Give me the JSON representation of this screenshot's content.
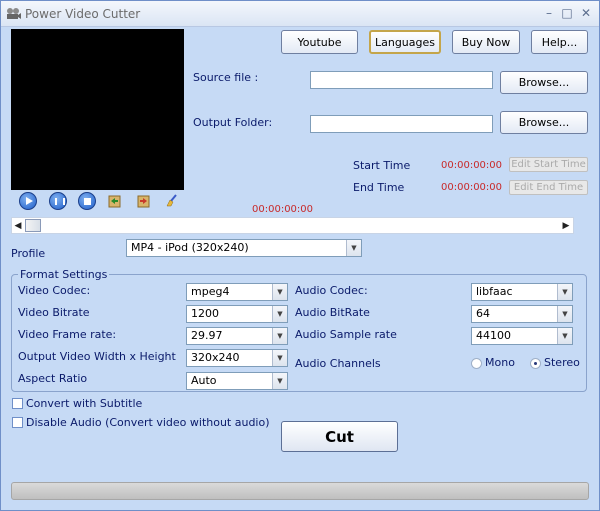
{
  "window": {
    "title": "Power Video Cutter",
    "minimize": "–",
    "maximize": "□",
    "close": "✕"
  },
  "toolbar": {
    "youtube": "Youtube",
    "languages": "Languages",
    "buy_now": "Buy Now",
    "help": "Help..."
  },
  "source": {
    "label": "Source file :",
    "value": "",
    "browse": "Browse..."
  },
  "output": {
    "label": "Output Folder:",
    "value": "",
    "browse": "Browse..."
  },
  "start_time": {
    "label": "Start Time",
    "value": "00:00:00:00",
    "edit": "Edit Start Time"
  },
  "end_time": {
    "label": "End Time",
    "value": "00:00:00:00",
    "edit": "Edit End Time"
  },
  "player": {
    "current_time": "00:00:00:00"
  },
  "profile": {
    "label": "Profile",
    "selected": "MP4 - iPod (320x240)"
  },
  "format": {
    "title": "Format Settings",
    "video_codec": {
      "label": "Video Codec:",
      "value": "mpeg4"
    },
    "video_bitrate": {
      "label": "Video Bitrate",
      "value": "1200"
    },
    "video_frame_rate": {
      "label": "Video Frame rate:",
      "value": "29.97"
    },
    "output_size": {
      "label": "Output Video Width x Height",
      "value": "320x240"
    },
    "aspect_ratio": {
      "label": "Aspect Ratio",
      "value": "Auto"
    },
    "audio_codec": {
      "label": "Audio Codec:",
      "value": "libfaac"
    },
    "audio_bitrate": {
      "label": "Audio BitRate",
      "value": "64"
    },
    "audio_sample_rate": {
      "label": "Audio Sample rate",
      "value": "44100"
    },
    "audio_channels": {
      "label": "Audio Channels",
      "mono": "Mono",
      "stereo": "Stereo",
      "selected": "Stereo"
    }
  },
  "options": {
    "convert_subtitle": "Convert with Subtitle",
    "disable_audio": "Disable Audio (Convert video without audio)"
  },
  "cut_button": "Cut",
  "colors": {
    "time_red": "#c82a2a",
    "label_blue": "#0a1a6a",
    "window_bg": "#c6daf5"
  }
}
